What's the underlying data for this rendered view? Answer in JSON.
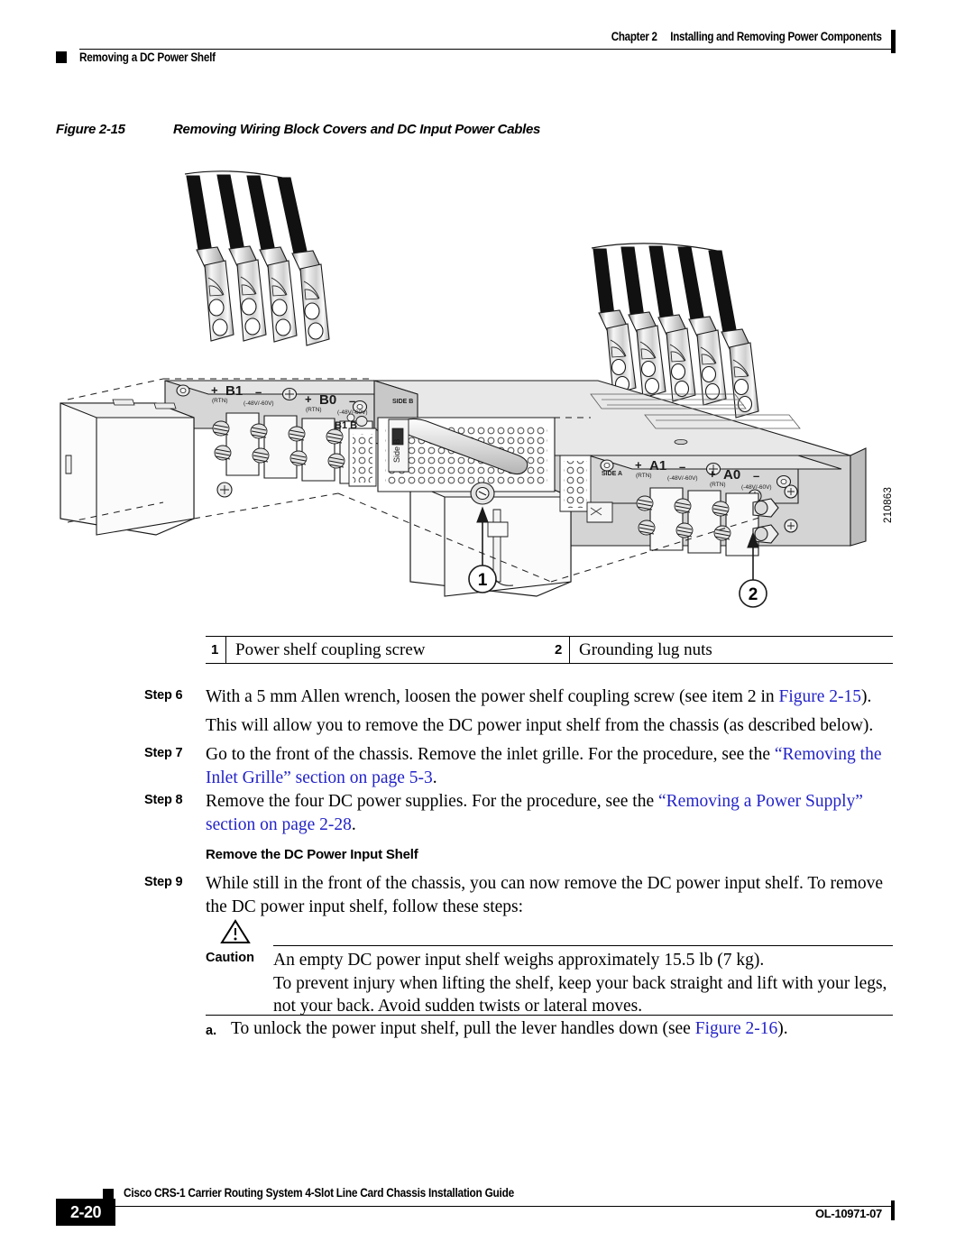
{
  "header": {
    "chapter_number": "Chapter 2",
    "chapter_title": "Installing and Removing Power Components",
    "section_title": "Removing a DC Power Shelf"
  },
  "figure": {
    "label": "Figure 2-15",
    "title": "Removing Wiring Block Covers and DC Input Power Cables",
    "art_id": "210863",
    "callouts": [
      {
        "number": "1",
        "text": "Power shelf coupling screw"
      },
      {
        "number": "2",
        "text": "Grounding lug nuts"
      }
    ],
    "block_labels": {
      "b1": "B1",
      "b0": "B0",
      "a1": "A1",
      "a0": "A0",
      "plus": "+",
      "minus": "–",
      "rtn": "(RTN)",
      "volts": "(-48V/-60V)",
      "side_b": "Side B",
      "side_a": "Side A"
    }
  },
  "legend": {
    "items": [
      {
        "number": "1",
        "text": "Power shelf coupling screw"
      },
      {
        "number": "2",
        "text": "Grounding lug nuts"
      }
    ]
  },
  "steps": [
    {
      "label": "Step 6",
      "parts": [
        {
          "text": "With a 5 mm Allen wrench, loosen the power shelf coupling screw (see item 2 in ",
          "link": false
        },
        {
          "text": "Figure 2-15",
          "link": true
        },
        {
          "text": ").",
          "link": false
        }
      ],
      "continuation": "This will allow you to remove the DC power input shelf from the chassis (as described below)."
    },
    {
      "label": "Step 7",
      "parts": [
        {
          "text": "Go to the front of the chassis. Remove the inlet grille. For the procedure, see the ",
          "link": false
        },
        {
          "text": "“Removing the Inlet Grille” section on page 5-3",
          "link": true
        },
        {
          "text": ".",
          "link": false
        }
      ]
    },
    {
      "label": "Step 8",
      "parts": [
        {
          "text": "Remove the four DC power supplies. For the procedure, see the ",
          "link": false
        },
        {
          "text": "“Removing a Power Supply” section on page 2-28",
          "link": true
        },
        {
          "text": ".",
          "link": false
        }
      ]
    },
    {
      "label": "Step 9",
      "parts": [
        {
          "text": "While still in the front of the chassis, you can now remove the DC power input shelf. To remove the DC power input shelf, follow these steps:",
          "link": false
        }
      ]
    }
  ],
  "subheading": "Remove the DC Power Input Shelf",
  "caution": {
    "label": "Caution",
    "icon": "warning-triangle-icon",
    "lines": [
      "An empty DC power input shelf weighs approximately 15.5 lb (7 kg).",
      "To prevent injury when lifting the shelf, keep your back straight and lift with your legs, not your back. Avoid sudden twists or lateral moves."
    ]
  },
  "substep": {
    "marker": "a.",
    "parts": [
      {
        "text": "To unlock the power input shelf, pull the lever handles down (see ",
        "link": false
      },
      {
        "text": "Figure 2-16",
        "link": true
      },
      {
        "text": ").",
        "link": false
      }
    ]
  },
  "footer": {
    "page_number": "2-20",
    "book_title": "Cisco CRS-1 Carrier Routing System 4-Slot Line Card Chassis Installation Guide",
    "doc_id": "OL-10971-07"
  },
  "colors": {
    "link": "#2323c8",
    "text": "#000000",
    "panel_fill": "#d4d4d4",
    "metal_light": "#f2f2f2",
    "cable": "#111111"
  }
}
